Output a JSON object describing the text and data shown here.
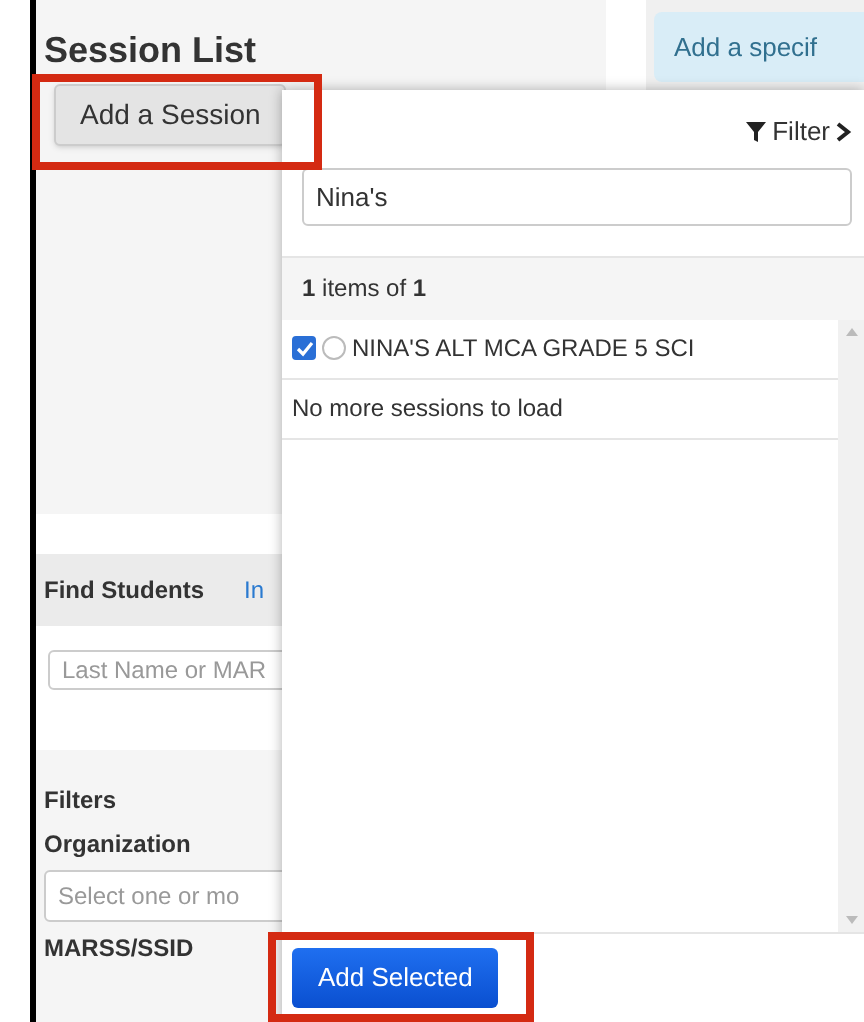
{
  "session_list": {
    "title": "Session List",
    "add_button": "Add a Session",
    "highlighted": true
  },
  "info_banner": {
    "text": "Add a specif"
  },
  "find_students": {
    "title": "Find Students",
    "link": "In",
    "search": {
      "placeholder": "Last Name or MAR"
    }
  },
  "filters": {
    "title": "Filters",
    "organization_label": "Organization",
    "organization_select": {
      "placeholder": "Select one or mo"
    },
    "marss_label": "MARSS/SSID"
  },
  "popup": {
    "filter_link": "Filter",
    "search": {
      "value": "Nina's"
    },
    "count": "**1** items of **1**",
    "items": [
      {
        "label": "NINA'S ALT MCA GRADE 5 SCI",
        "checked": true,
        "selected": false
      }
    ],
    "load_message": "No more sessions to load",
    "add_selected": "Add Selected",
    "add_selected_highlighted": true
  }
}
